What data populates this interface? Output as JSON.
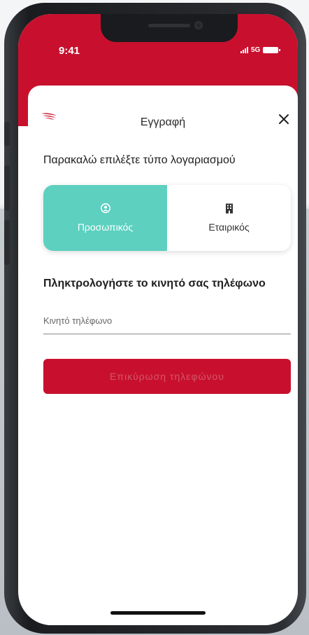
{
  "status_bar": {
    "time": "9:41",
    "network": "5G"
  },
  "header": {
    "title": "Εγγραφή",
    "logo_icon": "brand-wing-icon",
    "close_icon": "close-icon"
  },
  "account_type": {
    "prompt": "Παρακαλώ επιλέξτε τύπο λογαριασμού",
    "options": [
      {
        "label": "Προσωπικός",
        "icon": "user-circle-icon",
        "selected": true
      },
      {
        "label": "Εταιρικός",
        "icon": "building-icon",
        "selected": false
      }
    ]
  },
  "phone": {
    "prompt": "Πληκτρολογήστε το κινητό σας τηλέφωνο",
    "placeholder": "Κινητό τηλέφωνο",
    "value": ""
  },
  "confirm_button": {
    "label": "Επικύρωση τηλεφώνου",
    "enabled": false
  },
  "colors": {
    "brand_red": "#c8102e",
    "selected_teal": "#5dd0c0"
  }
}
